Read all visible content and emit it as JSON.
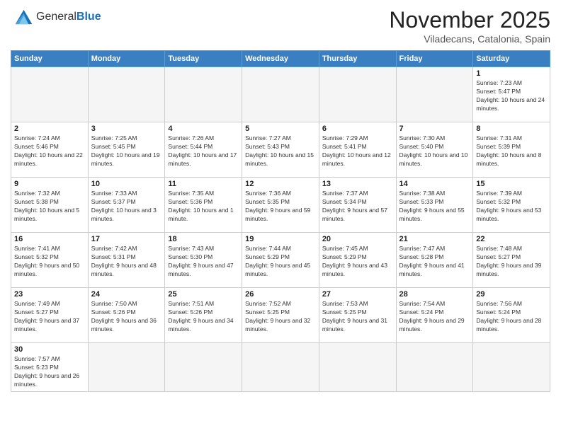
{
  "logo": {
    "line1": "General",
    "line2": "Blue"
  },
  "title": "November 2025",
  "location": "Viladecans, Catalonia, Spain",
  "weekdays": [
    "Sunday",
    "Monday",
    "Tuesday",
    "Wednesday",
    "Thursday",
    "Friday",
    "Saturday"
  ],
  "weeks": [
    [
      {
        "day": "",
        "info": ""
      },
      {
        "day": "",
        "info": ""
      },
      {
        "day": "",
        "info": ""
      },
      {
        "day": "",
        "info": ""
      },
      {
        "day": "",
        "info": ""
      },
      {
        "day": "",
        "info": ""
      },
      {
        "day": "1",
        "info": "Sunrise: 7:23 AM\nSunset: 5:47 PM\nDaylight: 10 hours and 24 minutes."
      }
    ],
    [
      {
        "day": "2",
        "info": "Sunrise: 7:24 AM\nSunset: 5:46 PM\nDaylight: 10 hours and 22 minutes."
      },
      {
        "day": "3",
        "info": "Sunrise: 7:25 AM\nSunset: 5:45 PM\nDaylight: 10 hours and 19 minutes."
      },
      {
        "day": "4",
        "info": "Sunrise: 7:26 AM\nSunset: 5:44 PM\nDaylight: 10 hours and 17 minutes."
      },
      {
        "day": "5",
        "info": "Sunrise: 7:27 AM\nSunset: 5:43 PM\nDaylight: 10 hours and 15 minutes."
      },
      {
        "day": "6",
        "info": "Sunrise: 7:29 AM\nSunset: 5:41 PM\nDaylight: 10 hours and 12 minutes."
      },
      {
        "day": "7",
        "info": "Sunrise: 7:30 AM\nSunset: 5:40 PM\nDaylight: 10 hours and 10 minutes."
      },
      {
        "day": "8",
        "info": "Sunrise: 7:31 AM\nSunset: 5:39 PM\nDaylight: 10 hours and 8 minutes."
      }
    ],
    [
      {
        "day": "9",
        "info": "Sunrise: 7:32 AM\nSunset: 5:38 PM\nDaylight: 10 hours and 5 minutes."
      },
      {
        "day": "10",
        "info": "Sunrise: 7:33 AM\nSunset: 5:37 PM\nDaylight: 10 hours and 3 minutes."
      },
      {
        "day": "11",
        "info": "Sunrise: 7:35 AM\nSunset: 5:36 PM\nDaylight: 10 hours and 1 minute."
      },
      {
        "day": "12",
        "info": "Sunrise: 7:36 AM\nSunset: 5:35 PM\nDaylight: 9 hours and 59 minutes."
      },
      {
        "day": "13",
        "info": "Sunrise: 7:37 AM\nSunset: 5:34 PM\nDaylight: 9 hours and 57 minutes."
      },
      {
        "day": "14",
        "info": "Sunrise: 7:38 AM\nSunset: 5:33 PM\nDaylight: 9 hours and 55 minutes."
      },
      {
        "day": "15",
        "info": "Sunrise: 7:39 AM\nSunset: 5:32 PM\nDaylight: 9 hours and 53 minutes."
      }
    ],
    [
      {
        "day": "16",
        "info": "Sunrise: 7:41 AM\nSunset: 5:32 PM\nDaylight: 9 hours and 50 minutes."
      },
      {
        "day": "17",
        "info": "Sunrise: 7:42 AM\nSunset: 5:31 PM\nDaylight: 9 hours and 48 minutes."
      },
      {
        "day": "18",
        "info": "Sunrise: 7:43 AM\nSunset: 5:30 PM\nDaylight: 9 hours and 47 minutes."
      },
      {
        "day": "19",
        "info": "Sunrise: 7:44 AM\nSunset: 5:29 PM\nDaylight: 9 hours and 45 minutes."
      },
      {
        "day": "20",
        "info": "Sunrise: 7:45 AM\nSunset: 5:29 PM\nDaylight: 9 hours and 43 minutes."
      },
      {
        "day": "21",
        "info": "Sunrise: 7:47 AM\nSunset: 5:28 PM\nDaylight: 9 hours and 41 minutes."
      },
      {
        "day": "22",
        "info": "Sunrise: 7:48 AM\nSunset: 5:27 PM\nDaylight: 9 hours and 39 minutes."
      }
    ],
    [
      {
        "day": "23",
        "info": "Sunrise: 7:49 AM\nSunset: 5:27 PM\nDaylight: 9 hours and 37 minutes."
      },
      {
        "day": "24",
        "info": "Sunrise: 7:50 AM\nSunset: 5:26 PM\nDaylight: 9 hours and 36 minutes."
      },
      {
        "day": "25",
        "info": "Sunrise: 7:51 AM\nSunset: 5:26 PM\nDaylight: 9 hours and 34 minutes."
      },
      {
        "day": "26",
        "info": "Sunrise: 7:52 AM\nSunset: 5:25 PM\nDaylight: 9 hours and 32 minutes."
      },
      {
        "day": "27",
        "info": "Sunrise: 7:53 AM\nSunset: 5:25 PM\nDaylight: 9 hours and 31 minutes."
      },
      {
        "day": "28",
        "info": "Sunrise: 7:54 AM\nSunset: 5:24 PM\nDaylight: 9 hours and 29 minutes."
      },
      {
        "day": "29",
        "info": "Sunrise: 7:56 AM\nSunset: 5:24 PM\nDaylight: 9 hours and 28 minutes."
      }
    ],
    [
      {
        "day": "30",
        "info": "Sunrise: 7:57 AM\nSunset: 5:23 PM\nDaylight: 9 hours and 26 minutes."
      },
      {
        "day": "",
        "info": ""
      },
      {
        "day": "",
        "info": ""
      },
      {
        "day": "",
        "info": ""
      },
      {
        "day": "",
        "info": ""
      },
      {
        "day": "",
        "info": ""
      },
      {
        "day": "",
        "info": ""
      }
    ]
  ]
}
